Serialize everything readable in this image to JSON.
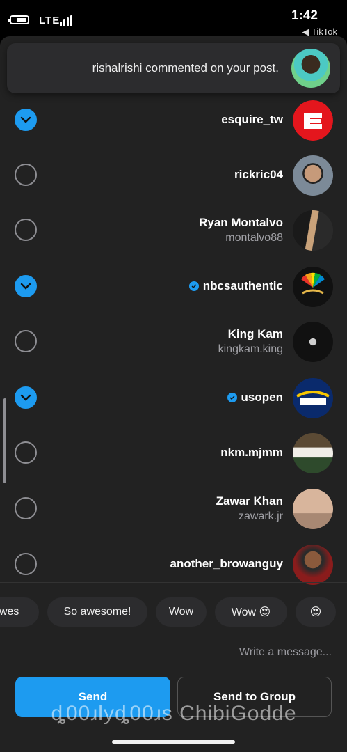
{
  "status": {
    "network": "LTE",
    "time": "1:42",
    "back_app": "◀ TikTok"
  },
  "notification": {
    "text": "rishalrishi commented on your post."
  },
  "contacts": [
    {
      "name": "esquire_tw",
      "username": "",
      "verified": false,
      "selected": true
    },
    {
      "name": "rickric04",
      "username": "",
      "verified": false,
      "selected": false
    },
    {
      "name": "Ryan Montalvo",
      "username": "montalvo88",
      "verified": false,
      "selected": false
    },
    {
      "name": "nbcsauthentic",
      "username": "",
      "verified": true,
      "selected": true
    },
    {
      "name": "King  Kam",
      "username": "kingkam.king",
      "verified": false,
      "selected": false
    },
    {
      "name": "usopen",
      "username": "",
      "verified": true,
      "selected": true
    },
    {
      "name": "nkm.mjmm",
      "username": "",
      "verified": false,
      "selected": false
    },
    {
      "name": "Zawar Khan",
      "username": "zawark.jr",
      "verified": false,
      "selected": false
    },
    {
      "name": "another_browanguy",
      "username": "",
      "verified": false,
      "selected": false
    }
  ],
  "quick_replies": [
    "😍",
    "Wow 😍",
    "Wow",
    "So awesome!",
    "Awes"
  ],
  "message_placeholder": "Write a message...",
  "buttons": {
    "send_to_group": "Send to Group",
    "send": "Send"
  },
  "watermark": "ȡ00ɹlyȡ00ɹs ChibiGodde",
  "colors": {
    "accent": "#1d9bf0",
    "sheet": "#222222",
    "background": "#000000"
  }
}
